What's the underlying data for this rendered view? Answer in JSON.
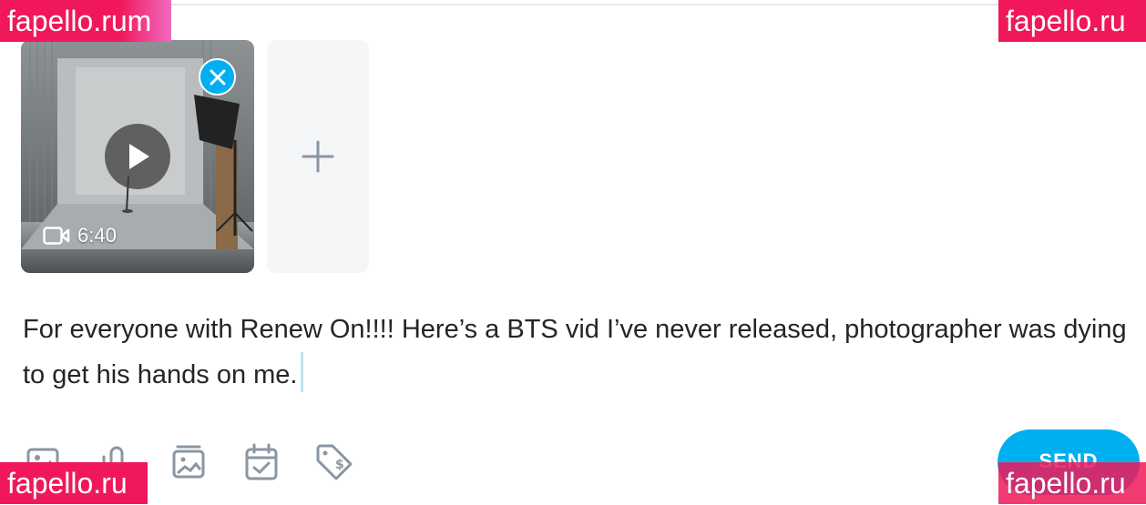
{
  "media": {
    "duration": "6:40",
    "icons": {
      "remove": "close-icon",
      "play": "play-icon",
      "video": "video-camera-icon",
      "add": "plus-icon"
    }
  },
  "post": {
    "text": "For everyone with Renew On!!!! Here’s a BTS vid I’ve never released, photographer was dying to get his hands on me."
  },
  "toolbar": {
    "items": [
      "image-icon",
      "attachment-icon",
      "gallery-icon",
      "calendar-check-icon",
      "price-tag-icon"
    ],
    "send_label": "SEND"
  },
  "watermarks": {
    "top_left": "fapello.rum",
    "top_right": "fapello.ru",
    "bottom_left": "fapello.ru",
    "bottom_right": "fapello.ru"
  },
  "colors": {
    "accent": "#00aff0",
    "watermark": "#f0185a",
    "icon": "#8a96a3",
    "text": "#242529"
  }
}
